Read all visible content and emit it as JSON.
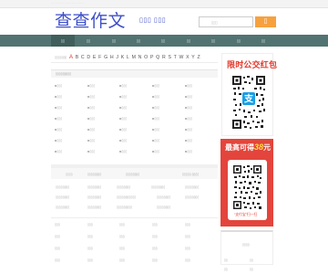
{
  "topbar": {
    "text": "······························"
  },
  "header": {
    "logo": "查查作文",
    "subtitle": "▯▯▯ ▯▯▯",
    "search_placeholder": "▯▯▯",
    "search_button": "▯"
  },
  "nav": {
    "items": [
      "▯▯",
      "▯▯",
      "▯▯",
      "▯▯",
      "▯▯",
      "▯▯",
      "▯▯",
      "▯▯",
      "▯▯"
    ]
  },
  "alphabet": {
    "prefix": "▯▯▯▯▯▯▯",
    "letters": [
      "A",
      "B",
      "C",
      "D",
      "E",
      "F",
      "G",
      "H",
      "J",
      "K",
      "L",
      "M",
      "N",
      "O",
      "P",
      "Q",
      "R",
      "S",
      "T",
      "W",
      "X",
      "Y",
      "Z"
    ]
  },
  "section": {
    "title": "▯▯▯▯▯▯▯▯▯"
  },
  "grid_items": "▯▯▯",
  "tags": {
    "col_heads": [
      "▯▯▯▯",
      "▯▯▯▯▯▯▯▯",
      "▯▯▯▯▯▯▯▯",
      "▯▯▯▯▯ ▯▯▯▯"
    ],
    "row_text": "▯▯▯▯▯▯▯▯",
    "row2_text": "▯▯▯▯▯▯▯▯▯▯▯",
    "row3_text": "▯▯▯▯▯▯▯▯▯"
  },
  "bottom_list": {
    "item": "▯▯▯"
  },
  "ads": {
    "ad1_title": "限时公交红包",
    "ad2_title_prefix": "最高可得",
    "ad2_amount": "38",
    "ad2_unit": "元",
    "ad2_caption": "“支付宝”扫一扫"
  },
  "right_panel": {
    "title": "▯▯▯▯",
    "links": [
      "▯▯",
      "▯▯",
      "▯▯",
      "▯▯"
    ]
  },
  "colors": {
    "brand": "#3d4ec9",
    "nav": "#517371",
    "nav_active": "#3f5e5c",
    "accent_red": "#e4392c",
    "search_orange": "#f7a13e"
  }
}
